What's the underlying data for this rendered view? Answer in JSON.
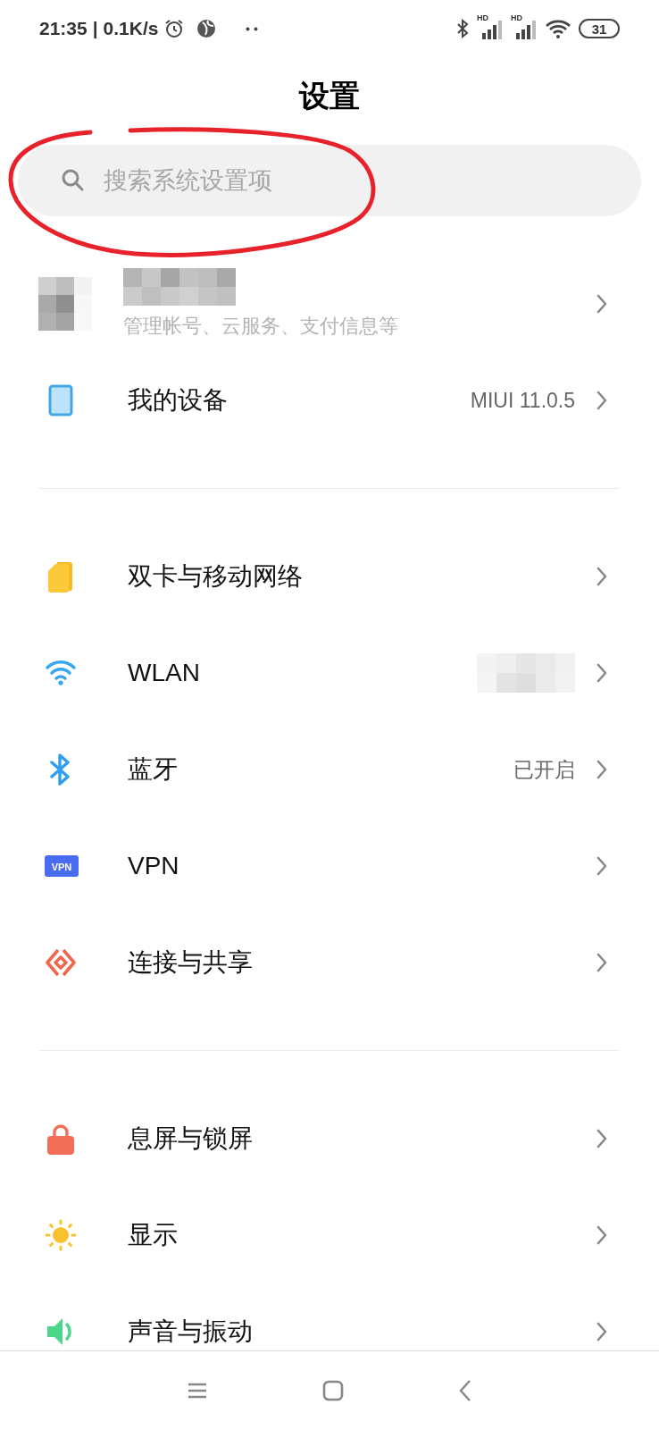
{
  "status_bar": {
    "time": "21:35",
    "separator": "|",
    "speed": "0.1K/s",
    "signals": [
      {
        "label": "HD"
      },
      {
        "label": "HD"
      }
    ],
    "battery": "31"
  },
  "title": "设置",
  "search": {
    "placeholder": "搜索系统设置项",
    "annotated": true
  },
  "account": {
    "subtitle": "管理帐号、云服务、支付信息等"
  },
  "sections": [
    {
      "items": [
        {
          "kind": "device",
          "label": "我的设备",
          "value": "MIUI 11.0.5"
        }
      ]
    },
    {
      "items": [
        {
          "kind": "sim",
          "label": "双卡与移动网络"
        },
        {
          "kind": "wlan",
          "label": "WLAN",
          "value_redacted": true
        },
        {
          "kind": "bluetooth",
          "label": "蓝牙",
          "value": "已开启"
        },
        {
          "kind": "vpn",
          "label": "VPN",
          "badge": "VPN"
        },
        {
          "kind": "share",
          "label": "连接与共享"
        }
      ]
    },
    {
      "items": [
        {
          "kind": "lock",
          "label": "息屏与锁屏"
        },
        {
          "kind": "display",
          "label": "显示"
        },
        {
          "kind": "sound",
          "label": "声音与振动"
        }
      ]
    }
  ]
}
